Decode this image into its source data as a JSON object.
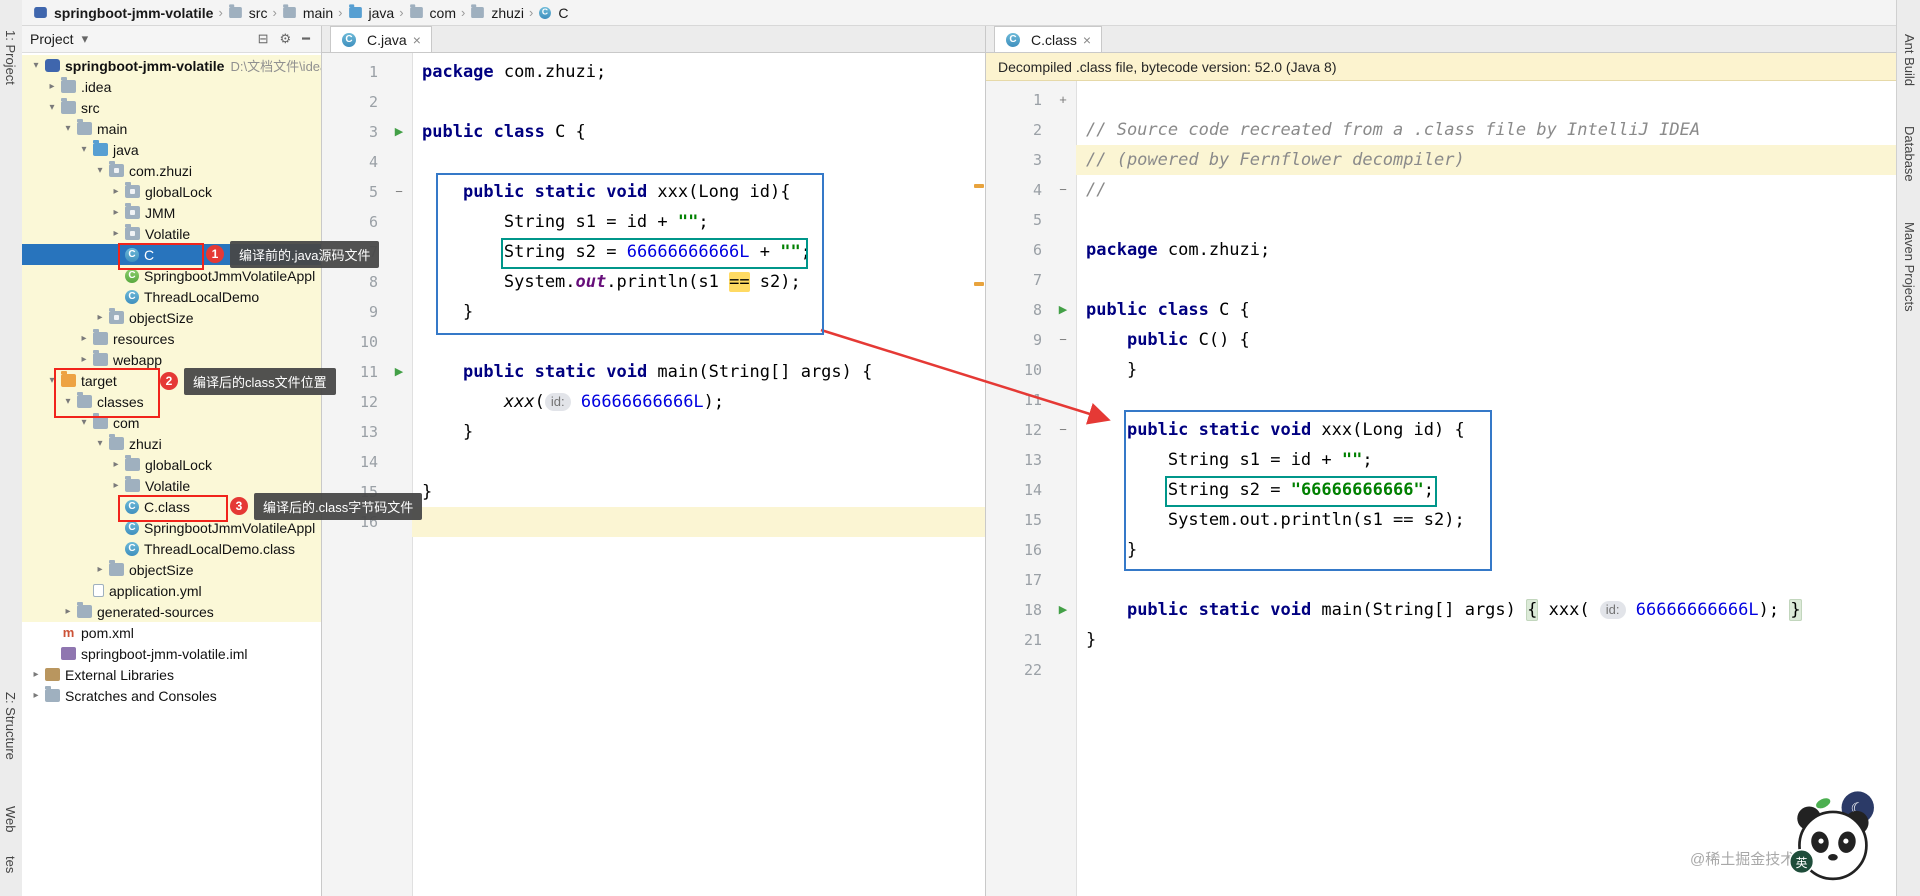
{
  "icons": {
    "caret": "▾",
    "gear": "⚙",
    "collapse": "⊟",
    "hide": "━",
    "close": "×",
    "crumb_sep": "›",
    "chev_down": "▾",
    "chev_right": "▸",
    "run": "▶",
    "fold_minus": "−",
    "fold_plus": "+",
    "class_letter": "C",
    "maven_letter": "m"
  },
  "left_toolbar": {
    "items": [
      "1: Project",
      "Z: Structure",
      "Web",
      "tes"
    ]
  },
  "right_toolbar": {
    "items": [
      "Ant Build",
      "Database",
      "Maven Projects"
    ]
  },
  "breadcrumbs": {
    "items": [
      {
        "label": "springboot-jmm-volatile",
        "icon": "project"
      },
      {
        "label": "src",
        "icon": "folder"
      },
      {
        "label": "main",
        "icon": "folder"
      },
      {
        "label": "java",
        "icon": "folder-src"
      },
      {
        "label": "com",
        "icon": "folder"
      },
      {
        "label": "zhuzi",
        "icon": "folder"
      },
      {
        "label": "C",
        "icon": "class"
      }
    ]
  },
  "project_panel": {
    "title": "Project",
    "tree": [
      {
        "label": "springboot-jmm-volatile",
        "suffix": "D:\\文档文件\\idea_",
        "depth": 0,
        "icon": "project",
        "chev": "d",
        "bg": "y",
        "bold": true
      },
      {
        "label": ".idea",
        "depth": 1,
        "icon": "folder",
        "chev": "r",
        "bg": "y"
      },
      {
        "label": "src",
        "depth": 1,
        "icon": "folder",
        "chev": "d",
        "bg": "y"
      },
      {
        "label": "main",
        "depth": 2,
        "icon": "folder",
        "chev": "d",
        "bg": "y"
      },
      {
        "label": "java",
        "depth": 3,
        "icon": "folder-src",
        "chev": "d",
        "bg": "y"
      },
      {
        "label": "com.zhuzi",
        "depth": 4,
        "icon": "pkg",
        "chev": "d",
        "bg": "y"
      },
      {
        "label": "globalLock",
        "depth": 5,
        "icon": "pkg",
        "chev": "r",
        "bg": "y"
      },
      {
        "label": "JMM",
        "depth": 5,
        "icon": "pkg",
        "chev": "r",
        "bg": "y"
      },
      {
        "label": "Volatile",
        "depth": 5,
        "icon": "pkg",
        "chev": "r",
        "bg": "y"
      },
      {
        "label": "C",
        "depth": 5,
        "icon": "class",
        "sel": true
      },
      {
        "label": "SpringbootJmmVolatileAppl",
        "depth": 5,
        "icon": "class-g",
        "bg": "y"
      },
      {
        "label": "ThreadLocalDemo",
        "depth": 5,
        "icon": "class",
        "bg": "y"
      },
      {
        "label": "objectSize",
        "depth": 4,
        "icon": "pkg",
        "chev": "r",
        "bg": "y"
      },
      {
        "label": "resources",
        "depth": 3,
        "icon": "folder",
        "chev": "r",
        "bg": "y"
      },
      {
        "label": "webapp",
        "depth": 3,
        "icon": "folder",
        "chev": "r",
        "bg": "y"
      },
      {
        "label": "target",
        "depth": 1,
        "icon": "folder-excl",
        "chev": "d",
        "bg": "y"
      },
      {
        "label": "classes",
        "depth": 2,
        "icon": "folder",
        "chev": "d",
        "bg": "y"
      },
      {
        "label": "com",
        "depth": 3,
        "icon": "folder",
        "chev": "d",
        "bg": "y"
      },
      {
        "label": "zhuzi",
        "depth": 4,
        "icon": "folder",
        "chev": "d",
        "bg": "y"
      },
      {
        "label": "globalLock",
        "depth": 5,
        "icon": "folder",
        "chev": "r",
        "bg": "y"
      },
      {
        "label": "Volatile",
        "depth": 5,
        "icon": "folder",
        "chev": "r",
        "bg": "y"
      },
      {
        "label": "C.class",
        "depth": 5,
        "icon": "class",
        "bg": "y"
      },
      {
        "label": "SpringbootJmmVolatileAppl",
        "depth": 5,
        "icon": "class",
        "bg": "y"
      },
      {
        "label": "ThreadLocalDemo.class",
        "depth": 5,
        "icon": "class",
        "bg": "y"
      },
      {
        "label": "objectSize",
        "depth": 4,
        "icon": "folder",
        "chev": "r",
        "bg": "y"
      },
      {
        "label": "application.yml",
        "depth": 3,
        "icon": "file",
        "bg": "y"
      },
      {
        "label": "generated-sources",
        "depth": 2,
        "icon": "folder",
        "chev": "r",
        "bg": "y"
      },
      {
        "label": "pom.xml",
        "depth": 1,
        "icon": "maven"
      },
      {
        "label": "springboot-jmm-volatile.iml",
        "depth": 1,
        "icon": "iml"
      },
      {
        "label": "External Libraries",
        "depth": 0,
        "icon": "lib",
        "chev": "r"
      },
      {
        "label": "Scratches and Consoles",
        "depth": 0,
        "icon": "scratch",
        "chev": "r"
      }
    ]
  },
  "editors": {
    "left": {
      "tab": "C.java",
      "lines": [
        {
          "n": "1",
          "t": [
            [
              "kw",
              "package"
            ],
            [
              "pl",
              " com.zhuzi;"
            ]
          ]
        },
        {
          "n": "2",
          "t": []
        },
        {
          "n": "3",
          "g": "run",
          "t": [
            [
              "kw",
              "public class"
            ],
            [
              "pl",
              " C {"
            ]
          ]
        },
        {
          "n": "4",
          "t": []
        },
        {
          "n": "5",
          "g": "fold",
          "t": [
            [
              "pl",
              "    "
            ],
            [
              "kw",
              "public static void"
            ],
            [
              "pl",
              " xxx(Long id){"
            ]
          ]
        },
        {
          "n": "6",
          "t": [
            [
              "pl",
              "        String s1 = id + "
            ],
            [
              "str",
              "\"\""
            ],
            [
              "pl",
              ";"
            ]
          ]
        },
        {
          "n": "7",
          "t": [
            [
              "pl",
              "        String s2 = "
            ],
            [
              "num",
              "66666666666L"
            ],
            [
              "pl",
              " + "
            ],
            [
              "str",
              "\"\""
            ],
            [
              "pl",
              ";"
            ]
          ]
        },
        {
          "n": "8",
          "t": [
            [
              "pl",
              "        System."
            ],
            [
              "field",
              "out"
            ],
            [
              "pl",
              ".println(s1 "
            ],
            [
              "hl",
              "=="
            ],
            [
              "pl",
              " s2);"
            ]
          ]
        },
        {
          "n": "9",
          "t": [
            [
              "pl",
              "    }"
            ]
          ]
        },
        {
          "n": "10",
          "t": []
        },
        {
          "n": "11",
          "g": "run",
          "t": [
            [
              "pl",
              "    "
            ],
            [
              "kw",
              "public static void"
            ],
            [
              "pl",
              " main(String[] args) {"
            ]
          ]
        },
        {
          "n": "12",
          "t": [
            [
              "pl",
              "        "
            ],
            [
              "it",
              "xxx"
            ],
            [
              "pl",
              "("
            ],
            [
              "hint",
              "id:"
            ],
            [
              "pl",
              " "
            ],
            [
              "num",
              "66666666666L"
            ],
            [
              "pl",
              ");"
            ]
          ]
        },
        {
          "n": "13",
          "t": [
            [
              "pl",
              "    }"
            ]
          ]
        },
        {
          "n": "14",
          "t": []
        },
        {
          "n": "15",
          "t": [
            [
              "pl",
              "}"
            ]
          ]
        },
        {
          "n": "16",
          "cur": true,
          "t": []
        }
      ]
    },
    "right": {
      "tab": "C.class",
      "notice": "Decompiled .class file, bytecode version: 52.0 (Java 8)",
      "lines": [
        {
          "n": "1",
          "g": "foldp",
          "t": []
        },
        {
          "n": "2",
          "t": [
            [
              "cmt",
              "// Source code recreated from a .class file by IntelliJ IDEA"
            ]
          ]
        },
        {
          "n": "3",
          "cur": true,
          "t": [
            [
              "cmt",
              "// (powered by Fernflower decompiler)"
            ]
          ]
        },
        {
          "n": "4",
          "g": "fold",
          "t": [
            [
              "cmt",
              "//"
            ]
          ]
        },
        {
          "n": "5",
          "t": []
        },
        {
          "n": "6",
          "t": [
            [
              "kw",
              "package"
            ],
            [
              "pl",
              " com.zhuzi;"
            ]
          ]
        },
        {
          "n": "7",
          "t": []
        },
        {
          "n": "8",
          "g": "run",
          "t": [
            [
              "kw",
              "public class"
            ],
            [
              "pl",
              " C {"
            ]
          ]
        },
        {
          "n": "9",
          "g": "fold",
          "t": [
            [
              "pl",
              "    "
            ],
            [
              "kw",
              "public"
            ],
            [
              "pl",
              " C() {"
            ]
          ]
        },
        {
          "n": "10",
          "t": [
            [
              "pl",
              "    }"
            ]
          ]
        },
        {
          "n": "11",
          "t": []
        },
        {
          "n": "12",
          "g": "fold",
          "t": [
            [
              "pl",
              "    "
            ],
            [
              "kw",
              "public static void"
            ],
            [
              "pl",
              " xxx(Long id) {"
            ]
          ]
        },
        {
          "n": "13",
          "t": [
            [
              "pl",
              "        String s1 = id + "
            ],
            [
              "str",
              "\"\""
            ],
            [
              "pl",
              ";"
            ]
          ]
        },
        {
          "n": "14",
          "t": [
            [
              "pl",
              "        String s2 = "
            ],
            [
              "str",
              "\"66666666666\""
            ],
            [
              "pl",
              ";"
            ]
          ]
        },
        {
          "n": "15",
          "t": [
            [
              "pl",
              "        System.out.println(s1 == s2);"
            ]
          ]
        },
        {
          "n": "16",
          "t": [
            [
              "pl",
              "    }"
            ]
          ]
        },
        {
          "n": "17",
          "t": []
        },
        {
          "n": "18",
          "g": "run",
          "t": [
            [
              "pl",
              "    "
            ],
            [
              "kw",
              "public static void"
            ],
            [
              "pl",
              " main(String[] args) "
            ],
            [
              "fold",
              "{"
            ],
            [
              "pl",
              " xxx( "
            ],
            [
              "hint",
              "id:"
            ],
            [
              "pl",
              " "
            ],
            [
              "num",
              "66666666666L"
            ],
            [
              "pl",
              "); "
            ],
            [
              "fold",
              "}"
            ]
          ]
        },
        {
          "n": "21",
          "t": [
            [
              "pl",
              "}"
            ]
          ]
        },
        {
          "n": "22",
          "t": []
        }
      ]
    }
  },
  "annotations": [
    {
      "num": "1",
      "label": "编译前的.java源码文件"
    },
    {
      "num": "2",
      "label": "编译后的class文件位置"
    },
    {
      "num": "3",
      "label": "编译后的.class字节码文件"
    }
  ],
  "watermark": {
    "handle": "@稀土掘金技术社区",
    "badge": "英"
  }
}
